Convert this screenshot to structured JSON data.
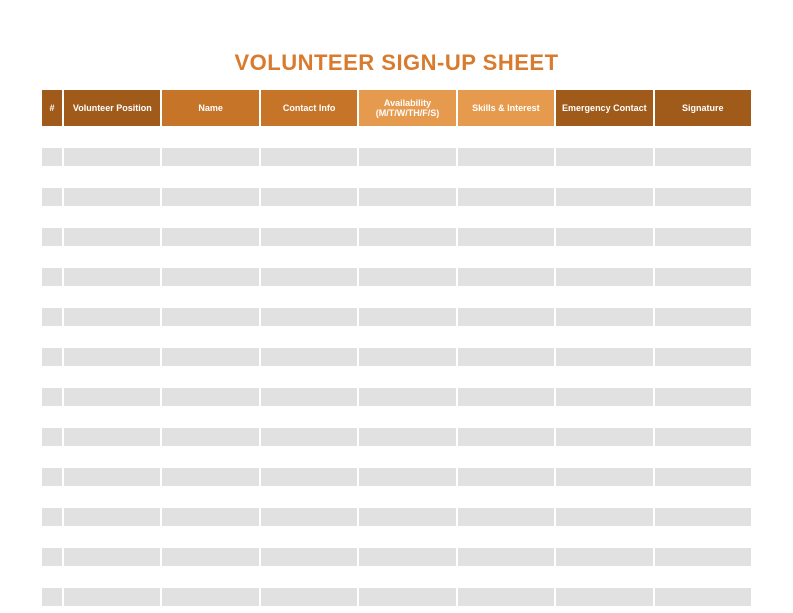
{
  "title": "VOLUNTEER SIGN-UP SHEET",
  "columns": [
    {
      "label": "#",
      "colorClass": "h-dark"
    },
    {
      "label": "Volunteer Position",
      "colorClass": "h-dark"
    },
    {
      "label": "Name",
      "colorClass": "h-mid"
    },
    {
      "label": "Contact Info",
      "colorClass": "h-mid"
    },
    {
      "label": "Availability (M/T/W/TH/F/S)",
      "colorClass": "h-light"
    },
    {
      "label": "Skills & Interest",
      "colorClass": "h-light"
    },
    {
      "label": "Emergency Contact",
      "colorClass": "h-dark"
    },
    {
      "label": "Signature",
      "colorClass": "h-dark"
    }
  ],
  "rows": [
    [
      "",
      "",
      "",
      "",
      "",
      "",
      "",
      ""
    ],
    [
      "",
      "",
      "",
      "",
      "",
      "",
      "",
      ""
    ],
    [
      "",
      "",
      "",
      "",
      "",
      "",
      "",
      ""
    ],
    [
      "",
      "",
      "",
      "",
      "",
      "",
      "",
      ""
    ],
    [
      "",
      "",
      "",
      "",
      "",
      "",
      "",
      ""
    ],
    [
      "",
      "",
      "",
      "",
      "",
      "",
      "",
      ""
    ],
    [
      "",
      "",
      "",
      "",
      "",
      "",
      "",
      ""
    ],
    [
      "",
      "",
      "",
      "",
      "",
      "",
      "",
      ""
    ],
    [
      "",
      "",
      "",
      "",
      "",
      "",
      "",
      ""
    ],
    [
      "",
      "",
      "",
      "",
      "",
      "",
      "",
      ""
    ],
    [
      "",
      "",
      "",
      "",
      "",
      "",
      "",
      ""
    ],
    [
      "",
      "",
      "",
      "",
      "",
      "",
      "",
      ""
    ],
    [
      "",
      "",
      "",
      "",
      "",
      "",
      "",
      ""
    ],
    [
      "",
      "",
      "",
      "",
      "",
      "",
      "",
      ""
    ],
    [
      "",
      "",
      "",
      "",
      "",
      "",
      "",
      ""
    ],
    [
      "",
      "",
      "",
      "",
      "",
      "",
      "",
      ""
    ],
    [
      "",
      "",
      "",
      "",
      "",
      "",
      "",
      ""
    ],
    [
      "",
      "",
      "",
      "",
      "",
      "",
      "",
      ""
    ],
    [
      "",
      "",
      "",
      "",
      "",
      "",
      "",
      ""
    ],
    [
      "",
      "",
      "",
      "",
      "",
      "",
      "",
      ""
    ],
    [
      "",
      "",
      "",
      "",
      "",
      "",
      "",
      ""
    ],
    [
      "",
      "",
      "",
      "",
      "",
      "",
      "",
      ""
    ],
    [
      "",
      "",
      "",
      "",
      "",
      "",
      "",
      ""
    ],
    [
      "",
      "",
      "",
      "",
      "",
      "",
      "",
      ""
    ]
  ],
  "colors": {
    "title": "#d97b2e",
    "headerDark": "#a05a1a",
    "headerMid": "#c67428",
    "headerLight": "#e69a4e",
    "rowGrey": "#e1e1e1",
    "rowWhite": "#ffffff"
  }
}
